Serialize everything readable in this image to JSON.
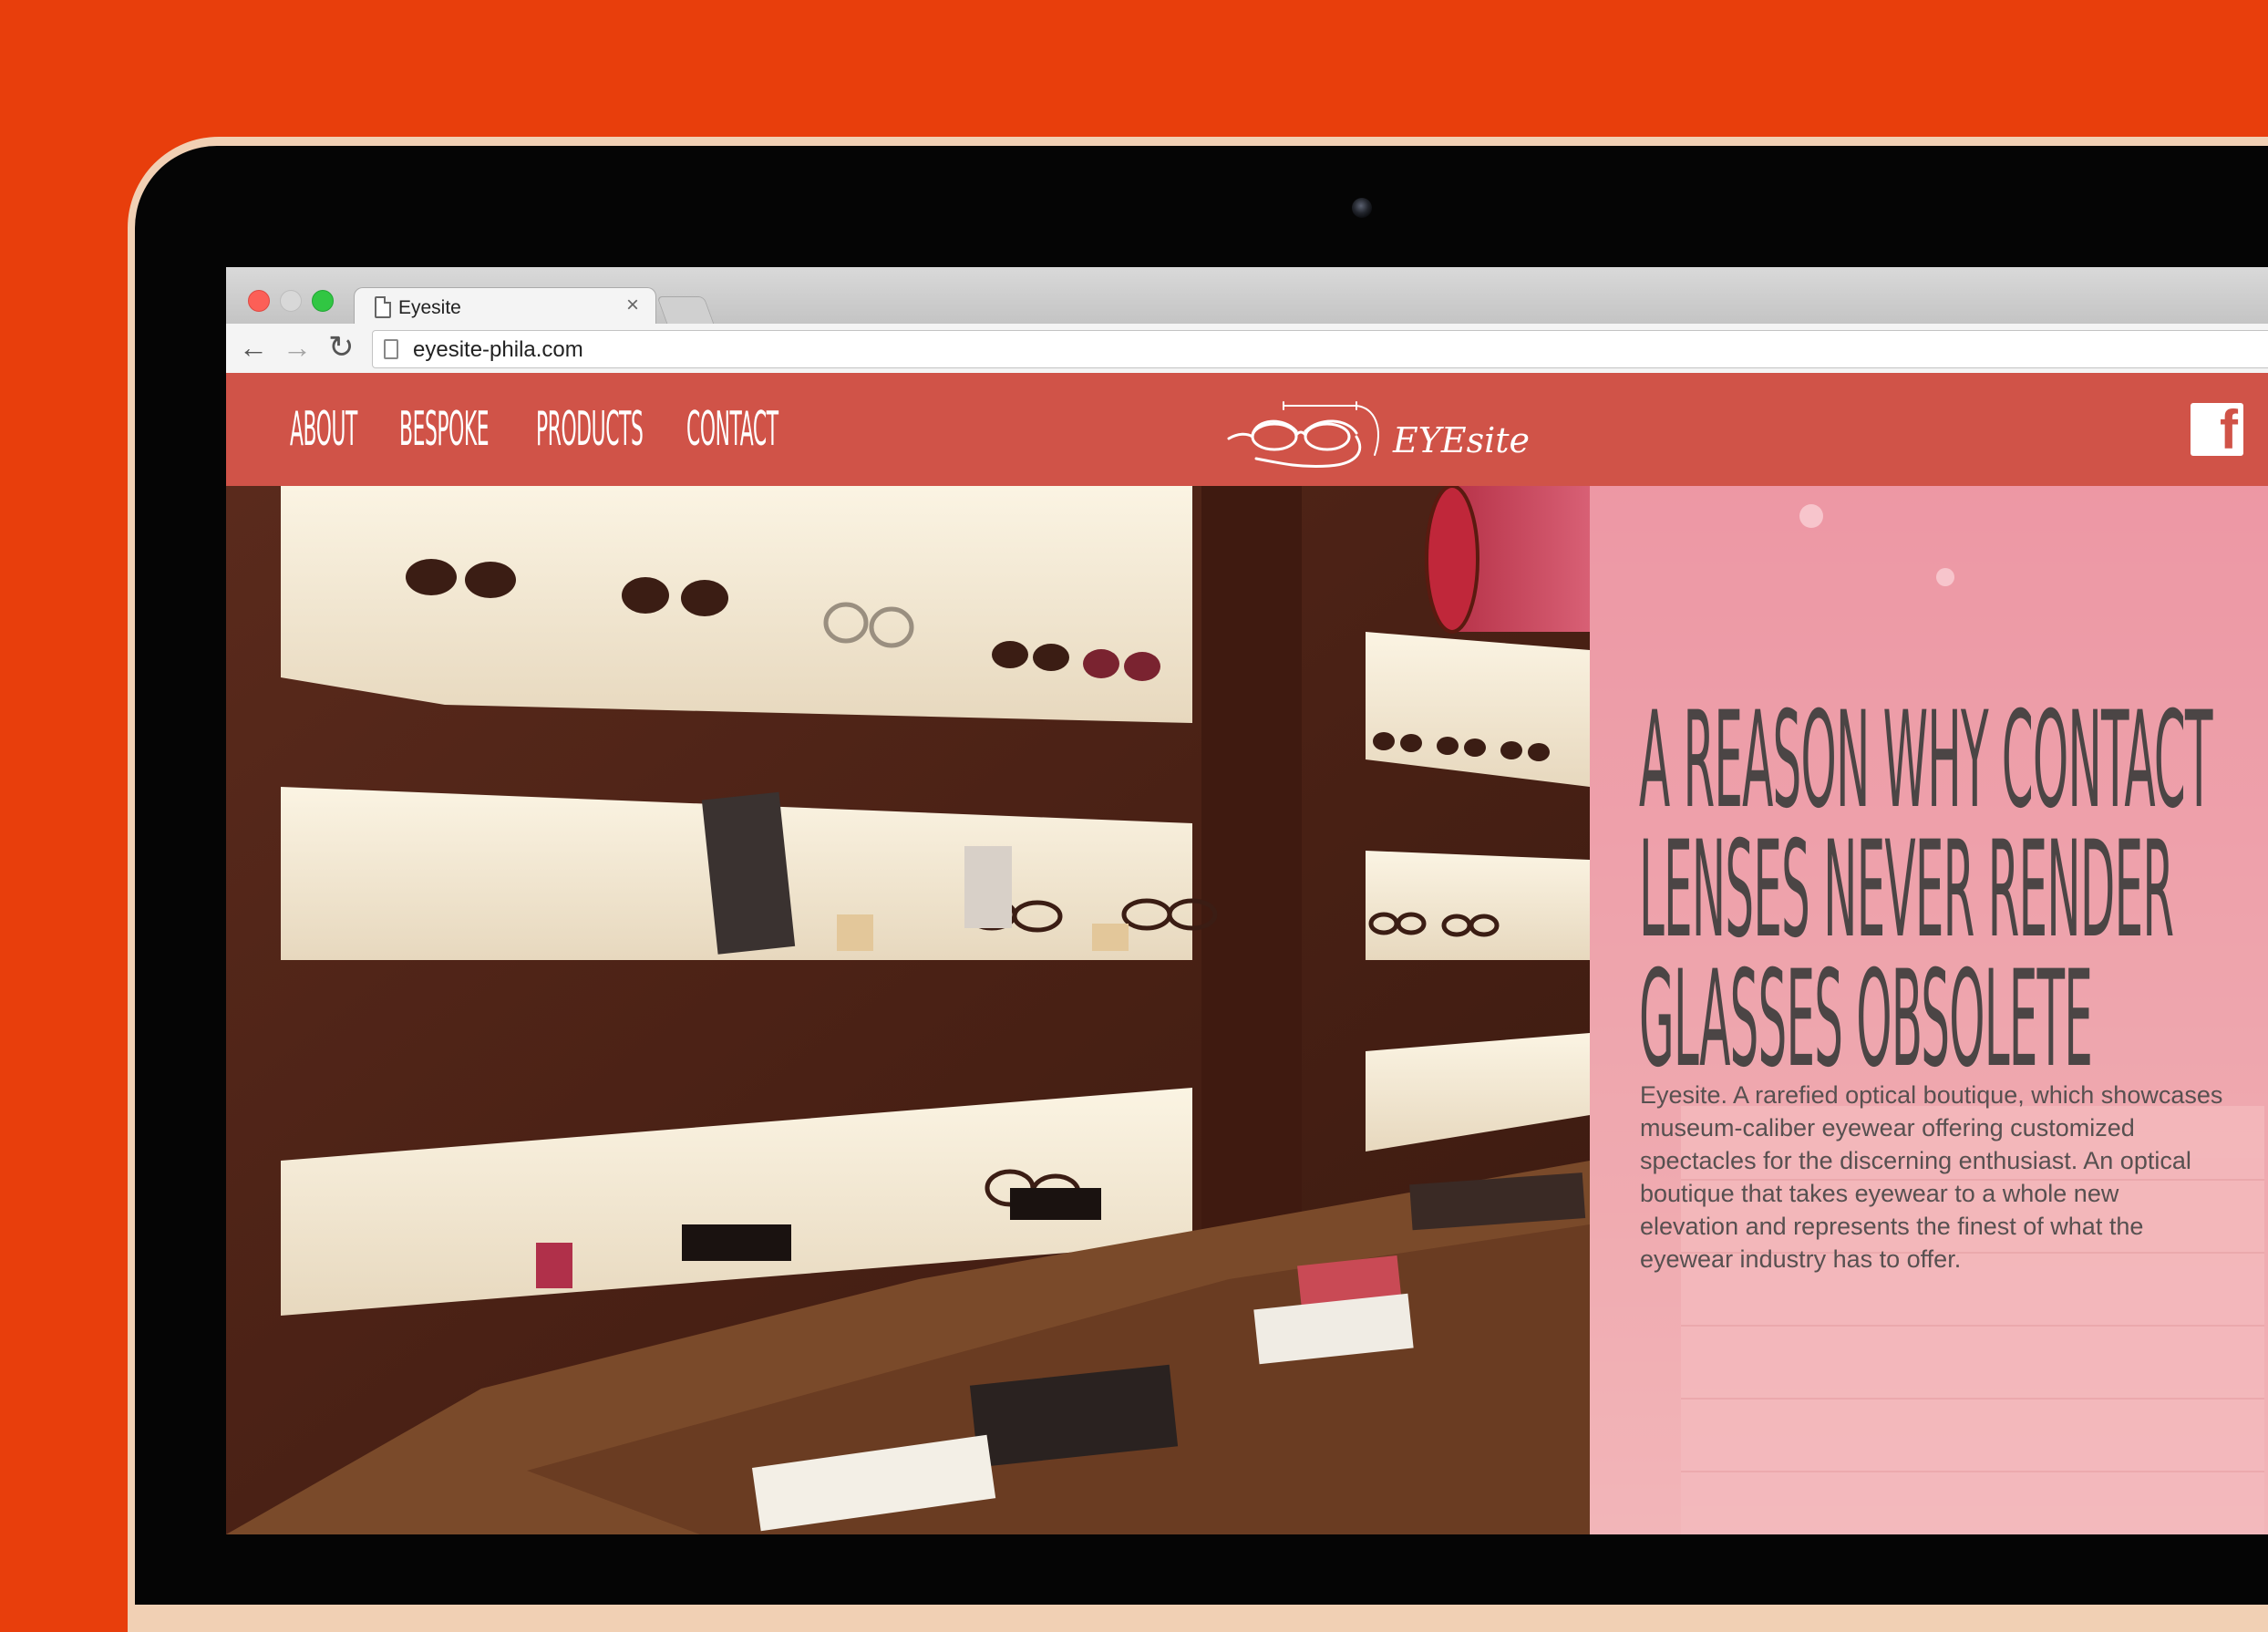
{
  "browser": {
    "tab_title": "Eyesite",
    "tab_close": "×",
    "url": "eyesite-phila.com",
    "back_icon": "arrow-left-icon",
    "forward_icon": "arrow-right-icon",
    "reload_icon": "reload-icon"
  },
  "site": {
    "nav": [
      "About",
      "Bespoke",
      "Products",
      "Contact"
    ],
    "logo_text": "EYEsite",
    "social_icon": "facebook-icon",
    "social_glyph": "f",
    "headline": [
      "A reason why contact",
      "lenses never render",
      "glasses obsolete"
    ],
    "description": "Eyesite. A rarefied optical boutique, which showcases museum-caliber eyewear offering customized spectacles for the discerning enthusiast. An optical boutique that takes eyewear to a whole new elevation and represents the finest of what the eyewear industry has to offer."
  },
  "colors": {
    "background": "#e83e0c",
    "header": "#d05348",
    "panel": "#f096a2",
    "headline_text": "#4b4545"
  }
}
